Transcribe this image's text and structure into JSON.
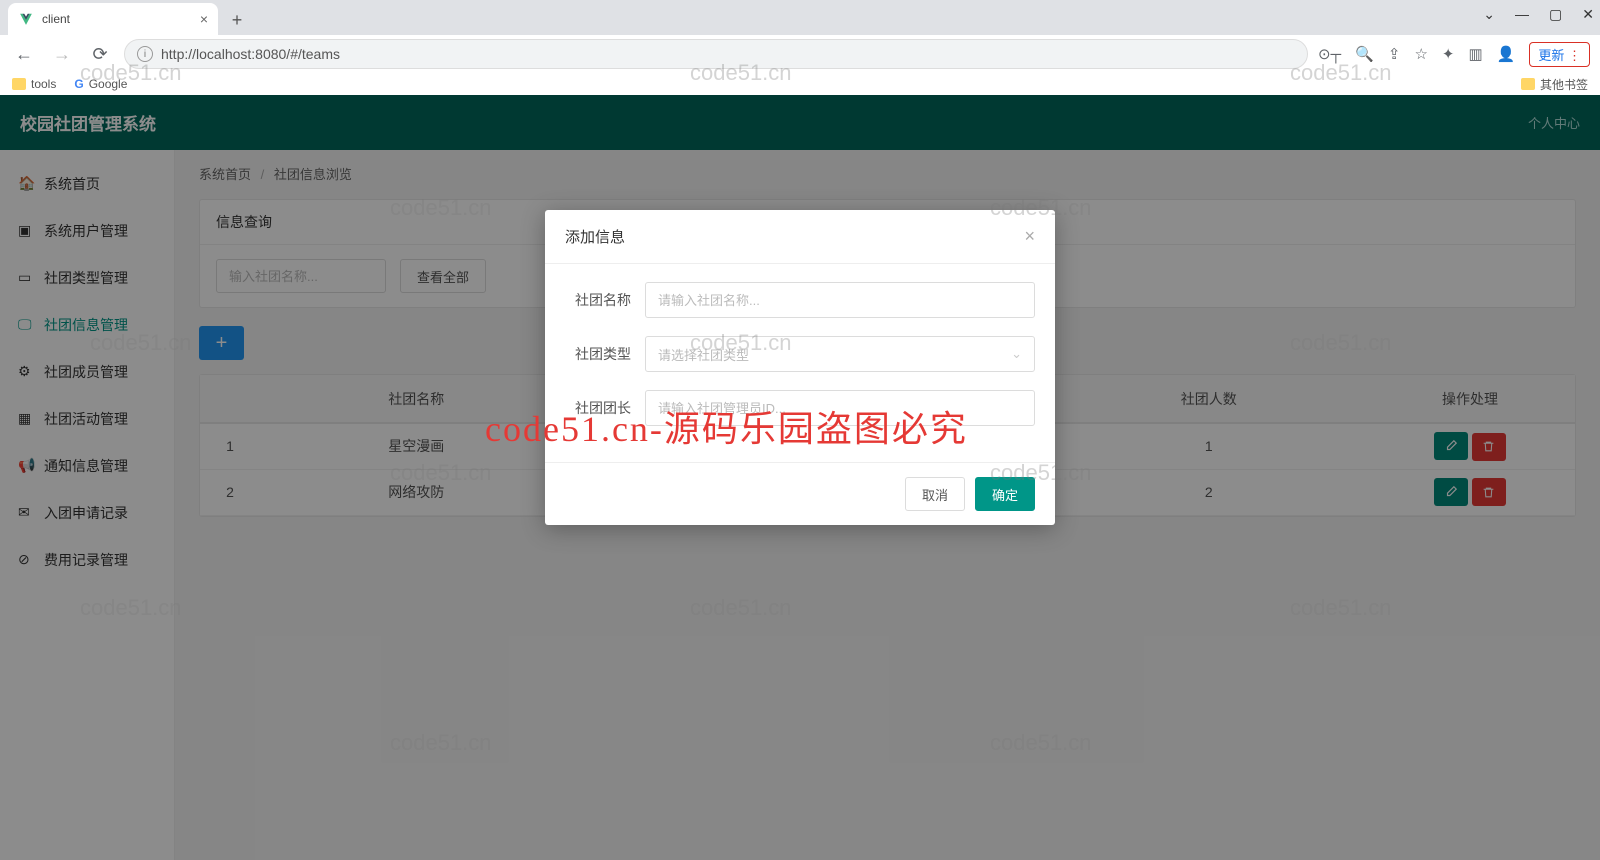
{
  "browser": {
    "tab_title": "client",
    "url": "http://localhost:8080/#/teams",
    "update_label": "更新",
    "bookmarks": {
      "tools": "tools",
      "google": "Google",
      "other": "其他书签"
    }
  },
  "header": {
    "title": "校园社团管理系统",
    "user_center": "个人中心"
  },
  "sidebar": {
    "items": [
      {
        "label": "系统首页",
        "icon": "home"
      },
      {
        "label": "系统用户管理",
        "icon": "user"
      },
      {
        "label": "社团类型管理",
        "icon": "type"
      },
      {
        "label": "社团信息管理",
        "icon": "info"
      },
      {
        "label": "社团成员管理",
        "icon": "member"
      },
      {
        "label": "社团活动管理",
        "icon": "activity"
      },
      {
        "label": "通知信息管理",
        "icon": "notice"
      },
      {
        "label": "入团申请记录",
        "icon": "apply"
      },
      {
        "label": "费用记录管理",
        "icon": "fee"
      }
    ]
  },
  "breadcrumb": {
    "home": "系统首页",
    "current": "社团信息浏览"
  },
  "search": {
    "card_title": "信息查询",
    "placeholder": "输入社团名称...",
    "view_all": "查看全部"
  },
  "table": {
    "headers": {
      "name": "社团名称",
      "count": "社团人数",
      "ops": "操作处理"
    },
    "rows": [
      {
        "idx": "1",
        "name": "星空漫画",
        "count": "1"
      },
      {
        "idx": "2",
        "name": "网络攻防",
        "count": "2"
      }
    ]
  },
  "modal": {
    "title": "添加信息",
    "fields": {
      "name_label": "社团名称",
      "name_ph": "请输入社团名称...",
      "type_label": "社团类型",
      "type_ph": "请选择社团类型",
      "leader_label": "社团团长",
      "leader_ph": "请输入社团管理员ID..."
    },
    "cancel": "取消",
    "confirm": "确定"
  },
  "watermark": {
    "small": "code51.cn",
    "big": "code51.cn-源码乐园盗图必究"
  }
}
